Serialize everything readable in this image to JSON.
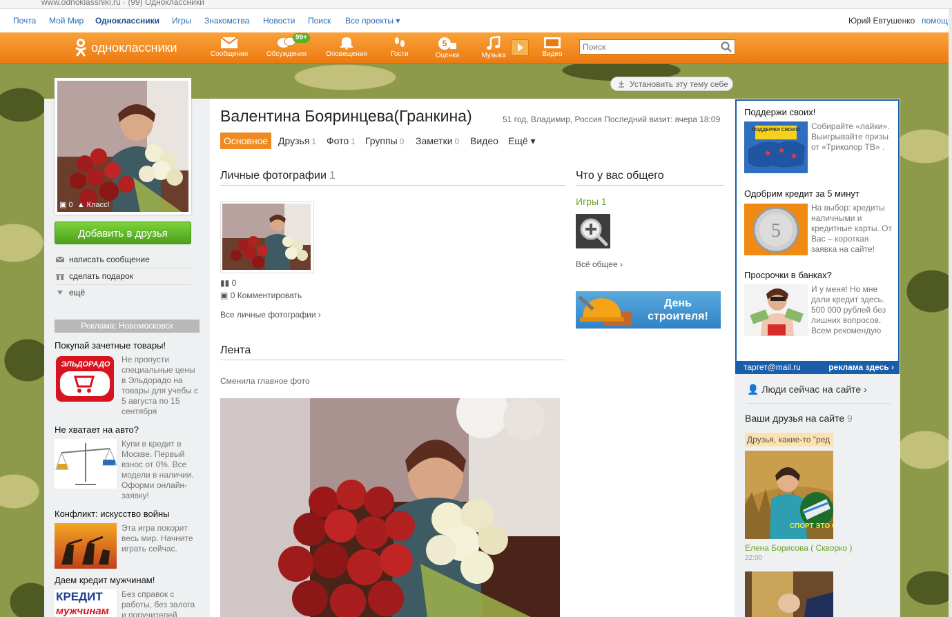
{
  "browser": {
    "url_fragment": "www.odnoklassniki.ru   ·   (99) Одноклассники"
  },
  "topnav": {
    "items": [
      "Почта",
      "Мой Мир",
      "Одноклассники",
      "Игры",
      "Знакомства",
      "Новости",
      "Поиск",
      "Все проекты ▾"
    ],
    "user": "Юрий Евтушенко",
    "extra": "помощь"
  },
  "header": {
    "logo": "одноклассники",
    "nav": [
      {
        "label": "Сообщения",
        "icon": "envelope-icon"
      },
      {
        "label": "Обсуждения",
        "icon": "chat-bubbles-icon",
        "badge": "99+"
      },
      {
        "label": "Оповещения",
        "icon": "bell-icon"
      },
      {
        "label": "Гости",
        "icon": "footprints-icon"
      },
      {
        "label": "Оценки",
        "icon": "rating-five-icon"
      },
      {
        "label": "Музыка",
        "icon": "music-note-icon"
      },
      {
        "label": "Видео",
        "icon": "video-icon"
      }
    ],
    "search_placeholder": "Поиск",
    "accent": "#ef8a21"
  },
  "theme_button": "Установить эту тему себе",
  "profile": {
    "name": "Валентина Бояринцева(Гранкина)",
    "meta": "51 год, Владимир, Россия  Последний визит: вчера 18:09",
    "avatar_comments": "0",
    "avatar_class": "Класс!",
    "add_friend": "Добавить в друзья",
    "actions": [
      "написать сообщение",
      "сделать подарок",
      "ещё"
    ]
  },
  "tabs": [
    {
      "label": "Основное",
      "count": ""
    },
    {
      "label": "Друзья",
      "count": "1"
    },
    {
      "label": "Фото",
      "count": "1"
    },
    {
      "label": "Группы",
      "count": "0"
    },
    {
      "label": "Заметки",
      "count": "0"
    },
    {
      "label": "Видео",
      "count": ""
    },
    {
      "label": "Ещё ▾",
      "count": ""
    }
  ],
  "photos": {
    "title": "Личные фотографии",
    "count": "1",
    "views": "0",
    "comments": "0 Комментировать",
    "all_link": "Все личные фотографии ›"
  },
  "common": {
    "title": "Что у вас общего",
    "games": "Игры 1",
    "all_link": "Всё общее ›",
    "banner": "День строителя!"
  },
  "feed": {
    "title": "Лента",
    "event": "Сменила главное фото"
  },
  "left_ads": {
    "header": "Реклама: Новомосковск",
    "items": [
      {
        "title": "Покупай зачетные товары!",
        "text": "Не пропусти специальные цены в Эльдорадо на товары для учебы с 5 августа по 15 сентября",
        "logo": "ЭЛЬДОРАДО"
      },
      {
        "title": "Не хватает на авто?",
        "text": "Купи в кредит в Москве. Первый взнос от 0%. Все модели в наличии. Оформи онлайн-заявку!"
      },
      {
        "title": "Конфликт: искусство войны",
        "text": "Эта игра покорит весь мир. Начните играть сейчас."
      },
      {
        "title": "Даем кредит мужчинам!",
        "text": "Без справок с работы, без залога и поручителей",
        "logo_top": "КРЕДИТ",
        "logo_bottom": "мужчинам"
      }
    ]
  },
  "target_ads": {
    "items": [
      {
        "title": "Поддержи своих!",
        "text": "Собирайте «лайки». Выигрывайте призы от «Триколор ТВ» .",
        "img_label": "ПОДДЕРЖИ СВОИХ!"
      },
      {
        "title": "Одобрим кредит за 5 минут",
        "text": "На выбор: кредиты наличными и кредитные карты. От Вас – короткая заявка на сайте!"
      },
      {
        "title": "Просрочки в банках?",
        "text": "И у меня! Но мне дали кредит здесь. 500 000 рублей без лишних вопросов. Всем рекомендую"
      }
    ],
    "footer_left": "таргет@mail.ru",
    "footer_right": "реклама здесь ›"
  },
  "right_column": {
    "people_now": "Люди сейчас на сайте ›",
    "friends_title": "Ваши друзья на сайте",
    "friends_count": "9",
    "friend_note": "Друзья, какие-то \"ред",
    "friend_name": "Елена Борисова ( Скворко )",
    "friend_time": "22:00",
    "sticker": "СПОРТ ЭТО ОК!"
  }
}
